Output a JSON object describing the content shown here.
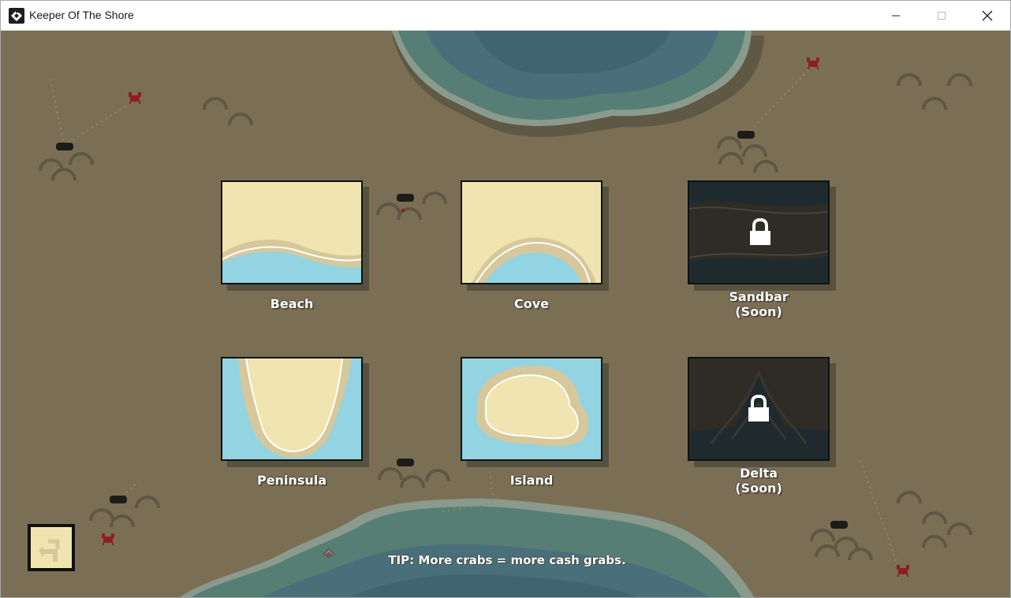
{
  "window": {
    "title": "Keeper Of The Shore",
    "controls": {
      "minimize": "minimize-icon",
      "maximize": "maximize-icon",
      "close": "close-icon"
    }
  },
  "levels": [
    {
      "name": "Beach",
      "locked": false,
      "art": "beach"
    },
    {
      "name": "Cove",
      "locked": false,
      "art": "cove"
    },
    {
      "name": "Sandbar\n(Soon)",
      "locked": true,
      "art": "sandbar"
    },
    {
      "name": "Peninsula",
      "locked": false,
      "art": "peninsula"
    },
    {
      "name": "Island",
      "locked": false,
      "art": "island"
    },
    {
      "name": "Delta\n(Soon)",
      "locked": true,
      "art": "delta"
    }
  ],
  "tip": "TIP: More crabs = more cash grabs.",
  "back_button": {
    "icon": "back-arrow-icon"
  },
  "colors": {
    "ground": "#7a6f55",
    "sand": "#f0e4b0",
    "wet_sand": "#d6c89a",
    "water": "#92d4e2",
    "locked_bg": "#2e2c24",
    "deep_water": "#3f6670",
    "crab": "#8f1f1f"
  }
}
